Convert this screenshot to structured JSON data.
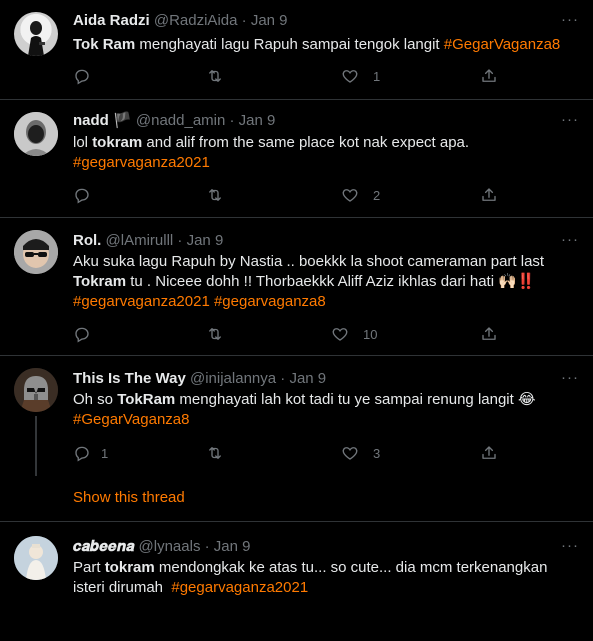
{
  "tweets": [
    {
      "name": "Aida Radzi",
      "handle": "@RadziAida",
      "sep": "·",
      "date": "Jan 9",
      "lines": [
        [
          {
            "t": "b",
            "v": "Tok Ram"
          },
          {
            "t": "n",
            "v": " menghayati lagu Rapuh sampai tengok langit "
          },
          {
            "t": "h",
            "v": "#GegarVaganza8"
          }
        ]
      ],
      "likes": "1"
    },
    {
      "name": "nadd",
      "name_suffix": "🏴",
      "handle": "@nadd_amin",
      "sep": "·",
      "date": "Jan 9",
      "lines": [
        [
          {
            "t": "n",
            "v": "lol "
          },
          {
            "t": "b",
            "v": "tokram"
          },
          {
            "t": "n",
            "v": " and alif from the same place kot nak expect apa."
          }
        ],
        [
          {
            "t": "h",
            "v": "#gegarvaganza2021"
          }
        ]
      ],
      "likes": "2"
    },
    {
      "name": "Rol.",
      "handle": "@lAmirulll",
      "sep": "·",
      "date": "Jan 9",
      "lines": [
        [
          {
            "t": "n",
            "v": "Aku suka lagu Rapuh by Nastia .. boekkk la shoot cameraman part last"
          }
        ],
        [
          {
            "t": "b",
            "v": "Tokram"
          },
          {
            "t": "n",
            "v": " tu . Niceee dohh !! Thorbaekkk Aliff Aziz ikhlas dari hati 🙌🏻‼️"
          }
        ],
        [
          {
            "t": "h",
            "v": "#gegarvaganza2021"
          },
          {
            "t": "n",
            "v": " "
          },
          {
            "t": "h",
            "v": "#gegarvaganza8"
          }
        ]
      ],
      "likes": "10"
    },
    {
      "name": "This Is The Way",
      "handle": "@inijalannya",
      "sep": "·",
      "date": "Jan 9",
      "lines": [
        [
          {
            "t": "n",
            "v": "Oh so "
          },
          {
            "t": "b",
            "v": "TokRam"
          },
          {
            "t": "n",
            "v": " menghayati lah kot tadi tu ye sampai renung langit 😂"
          }
        ],
        [
          {
            "t": "h",
            "v": "#GegarVaganza8"
          }
        ]
      ],
      "replies": "1",
      "likes": "3",
      "show_thread": "Show this thread"
    },
    {
      "name": "𝒄𝒂𝒃𝒆𝒆𝒏𝒂",
      "handle": "@lynaals",
      "sep": "·",
      "date": "Jan 9",
      "lines": [
        [
          {
            "t": "n",
            "v": "Part "
          },
          {
            "t": "b",
            "v": "tokram"
          },
          {
            "t": "n",
            "v": " mendongkak ke atas tu... so cute... dia mcm terkenangkan"
          }
        ],
        [
          {
            "t": "n",
            "v": "isteri dirumah  "
          },
          {
            "t": "h",
            "v": "#gegarvaganza2021"
          }
        ]
      ]
    }
  ],
  "more_label": "···",
  "colors": {
    "accent": "#ff7a00",
    "muted": "#71767b",
    "text": "#e7e9ea",
    "bg": "#000000"
  },
  "icons": [
    "reply-icon",
    "retweet-icon",
    "like-icon",
    "share-icon",
    "more-icon"
  ]
}
